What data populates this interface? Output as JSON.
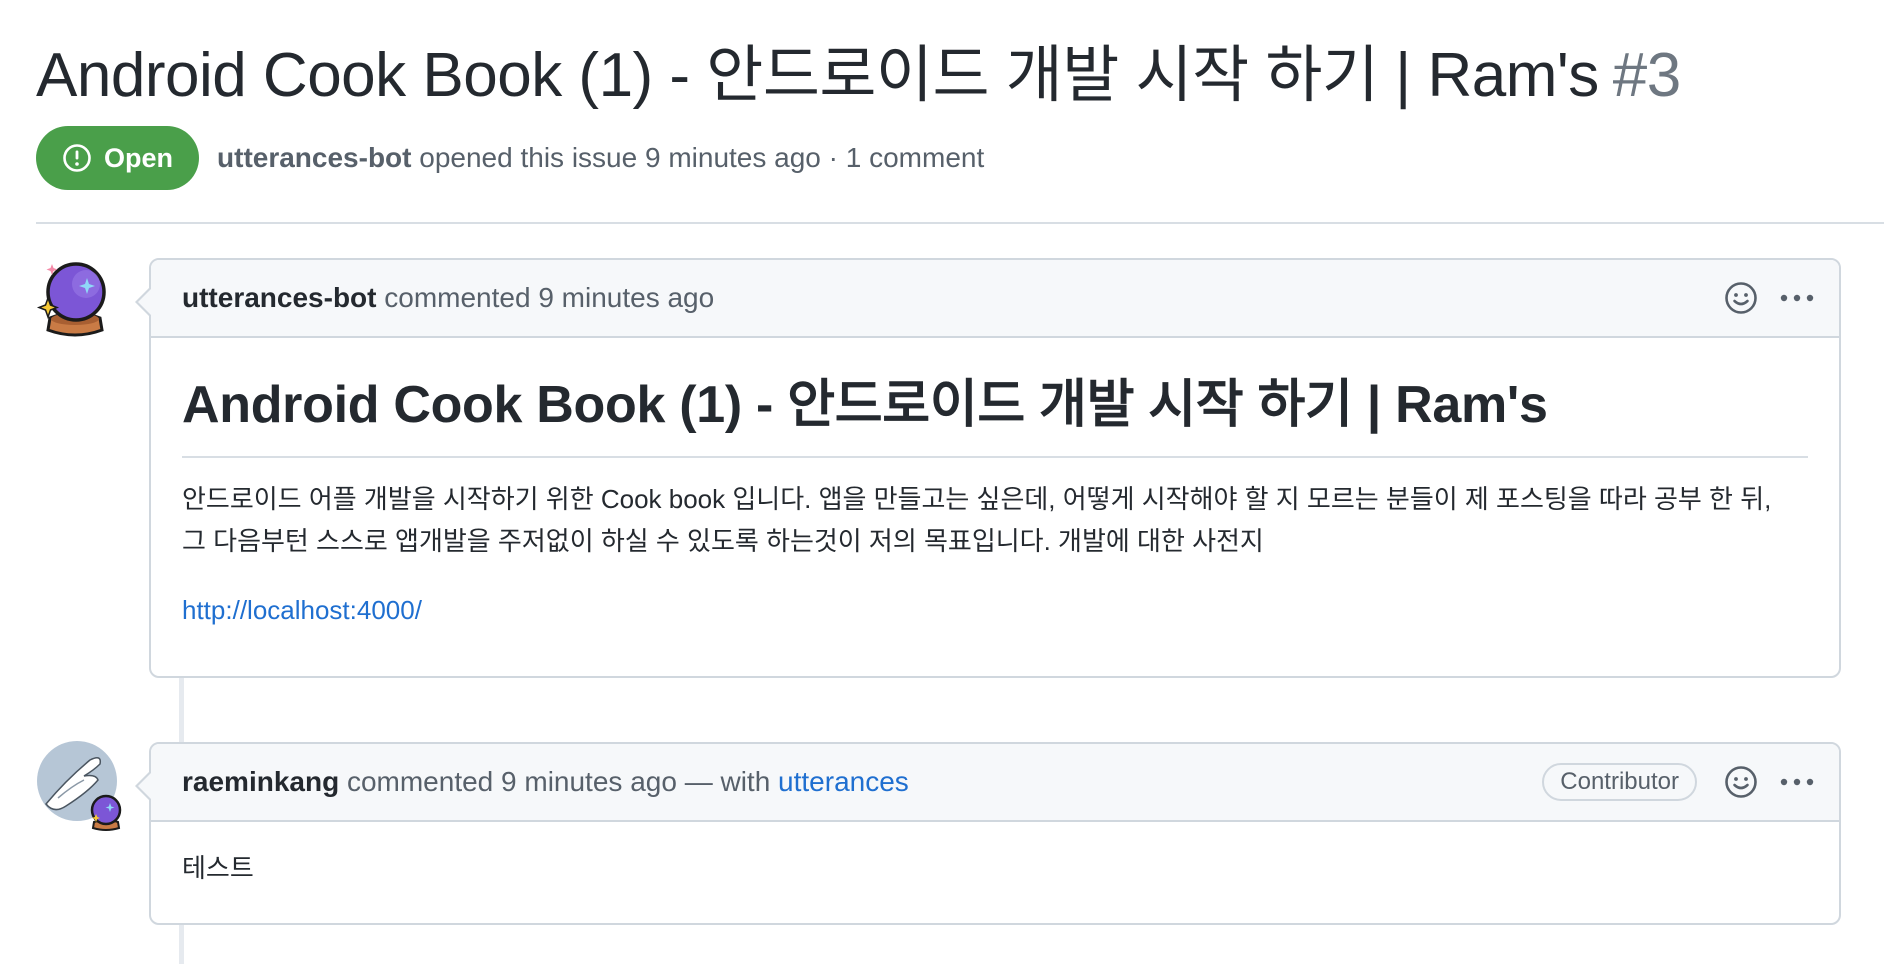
{
  "issue": {
    "title": "Android Cook Book (1) - 안드로이드 개발 시작 하기 | Ram's",
    "number": "#3",
    "state": "Open",
    "author": "utterances-bot",
    "meta_suffix": " opened this issue 9 minutes ago · 1 comment"
  },
  "comments": [
    {
      "author": "utterances-bot",
      "action_text": " commented 9 minutes ago",
      "heading": "Android Cook Book (1) - 안드로이드 개발 시작 하기 | Ram's",
      "paragraph_line1": "안드로이드 어플 개발을 시작하기 위한 Cook book 입니다. 앱을 만들고는 싶은데, 어떻게 시작해야 할 지 모르는 분들이 제 포스팅을 따라 공부 한 뒤,",
      "paragraph_line2": "그 다음부턴 스스로 앱개발을 주저없이 하실 수 있도록 하는것이 저의 목표입니다. 개발에 대한 사전지",
      "link": "http://localhost:4000/",
      "avatar_icon": "crystal-ball-icon"
    },
    {
      "author": "raeminkang",
      "action_text": " commented 9 minutes ago — with ",
      "via_link": "utterances",
      "badge": "Contributor",
      "body": "테스트",
      "avatar_icon": "user-avatar-with-crystal-ball-icon"
    }
  ],
  "colors": {
    "open_badge": "#4a9f4a",
    "link": "#1f6fd0",
    "muted": "#57606a",
    "border": "#d0d7de",
    "header_bg": "#f6f8fa"
  }
}
